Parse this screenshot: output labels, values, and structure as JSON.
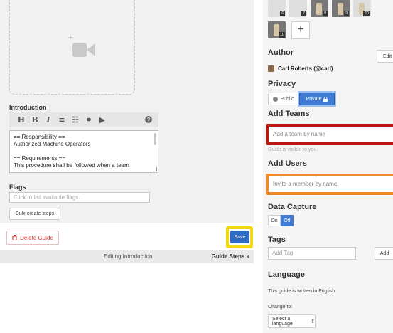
{
  "editor": {
    "intro_title": "Introduction",
    "toolbar": [
      "H",
      "B",
      "I",
      "≡",
      "☷",
      "⚭",
      "▶",
      "?"
    ],
    "intro_lines": [
      "== Responsibility ==",
      "Authorized Machine Operators",
      "",
      "== Requirements ==",
      "This procedure shall be followed when a team"
    ],
    "flags_title": "Flags",
    "flags_placeholder": "Click to list available flags...",
    "bulk_label": "Bulk-create steps",
    "delete_label": "Delete Guide",
    "save_label": "Save",
    "status_editing": "Editing Introduction",
    "status_steps": "Guide Steps »"
  },
  "sidebar": {
    "photos": [
      "6",
      "7",
      "8",
      "9",
      "10",
      "11"
    ],
    "add_photo": "+",
    "author_title": "Author",
    "author_edit": "Edit",
    "author_name": "Carl Roberts (@carl)",
    "privacy_title": "Privacy",
    "privacy_public": "Public",
    "privacy_private": "Private",
    "teams_title": "Add Teams",
    "teams_placeholder": "Add a team by name",
    "teams_hint": "Guide is visible to you.",
    "users_title": "Add Users",
    "users_placeholder": "Invite a member by name",
    "capture_title": "Data Capture",
    "capture_on": "On",
    "capture_off": "Off",
    "tags_title": "Tags",
    "tags_placeholder": "Add Tag",
    "tags_add": "Add",
    "lang_title": "Language",
    "lang_written": "This guide is written in English",
    "lang_change": "Change to:",
    "lang_select": "Select a language"
  },
  "colors": {
    "accent": "#3f7bd3",
    "team_highlight": "#b8180f",
    "users_highlight": "#f08a25",
    "save_highlight": "#f3d90f"
  }
}
